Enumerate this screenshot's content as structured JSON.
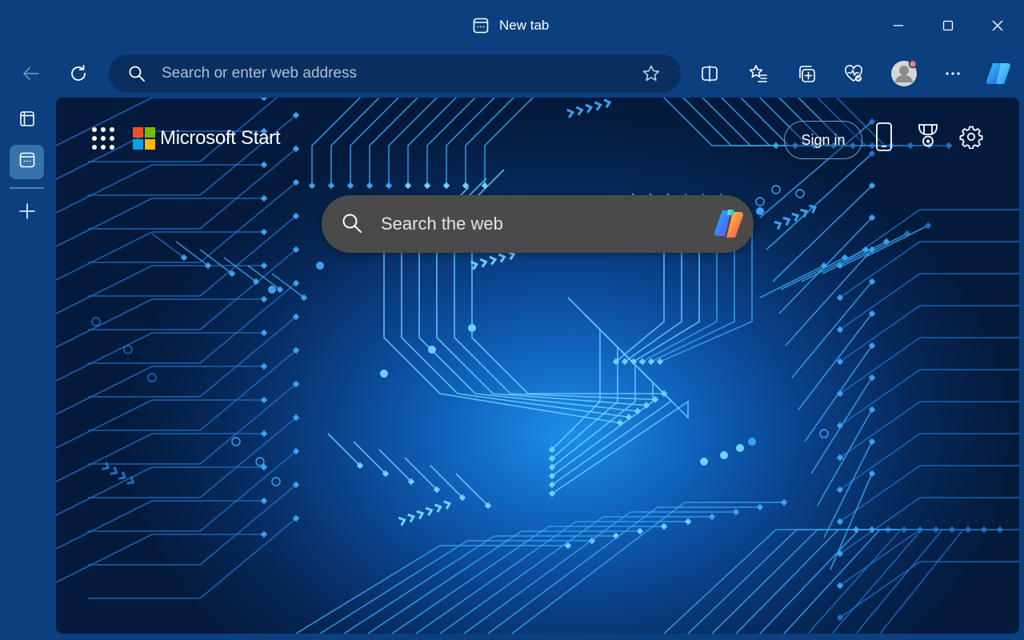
{
  "window": {
    "tab_title": "New tab"
  },
  "toolbar": {
    "address_placeholder": "Search or enter web address"
  },
  "newtab": {
    "brand": "Microsoft Start",
    "signin_label": "Sign in",
    "search_placeholder": "Search the web"
  },
  "colors": {
    "frame": "#0b3f7f",
    "address_bar": "#0a2f5e",
    "search_box": "#4a4a4a",
    "ms_red": "#f25022",
    "ms_green": "#7fba00",
    "ms_blue": "#00a4ef",
    "ms_yellow": "#ffb900"
  },
  "icons": {
    "titlebar": [
      "new-tab-page-icon",
      "minimize-icon",
      "maximize-icon",
      "close-icon"
    ],
    "toolbar": [
      "back-icon",
      "refresh-icon",
      "search-icon",
      "star-icon",
      "split-screen-icon",
      "favorites-icon",
      "collections-icon",
      "browser-essentials-icon",
      "profile-avatar-icon",
      "more-icon",
      "copilot-icon"
    ],
    "rail": [
      "tab-actions-icon",
      "tab-page-icon",
      "new-tab-plus-icon"
    ],
    "newtab": [
      "apps-grid-icon",
      "microsoft-logo",
      "phone-icon",
      "rewards-trophy-icon",
      "settings-gear-icon",
      "copilot-icon"
    ]
  }
}
